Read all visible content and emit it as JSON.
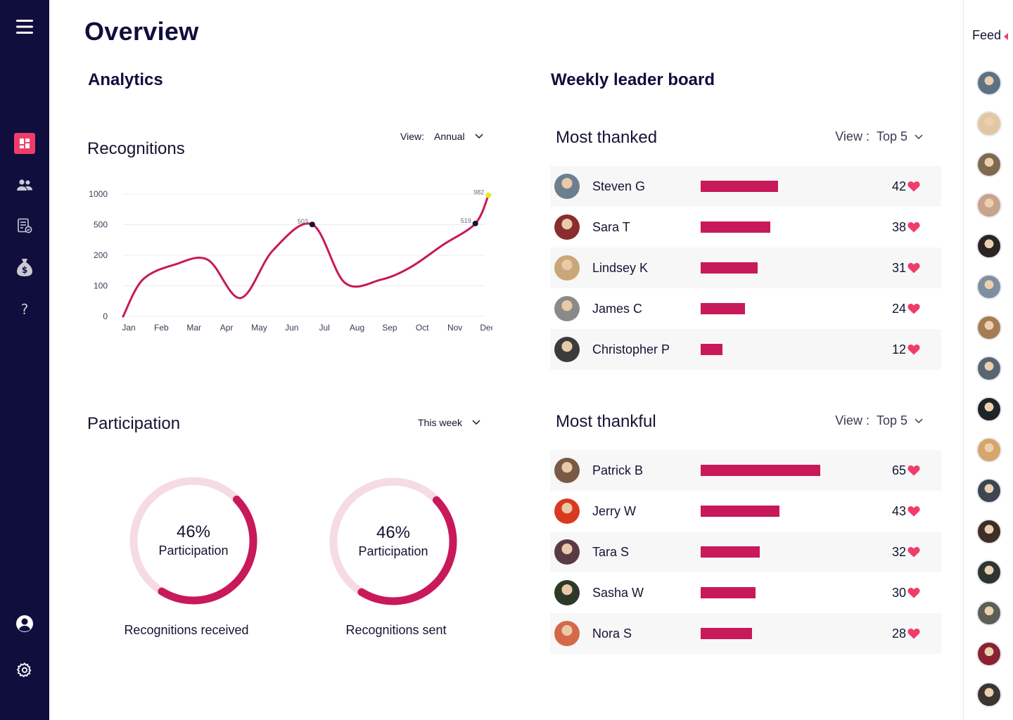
{
  "page": {
    "title": "Overview"
  },
  "sidebar": {
    "menu_icon": "hamburger-menu-icon",
    "items": [
      {
        "icon": "dashboard-icon",
        "active": true
      },
      {
        "icon": "people-icon",
        "active": false
      },
      {
        "icon": "report-icon",
        "active": false
      },
      {
        "icon": "money-bag-icon",
        "active": false
      },
      {
        "icon": "help-icon",
        "glyph": "?",
        "active": false
      }
    ],
    "bottom": [
      {
        "icon": "account-icon"
      },
      {
        "icon": "settings-gear-icon"
      }
    ]
  },
  "analytics": {
    "title": "Analytics",
    "recognitions": {
      "title": "Recognitions",
      "view_label": "View:",
      "view_value": "Annual"
    },
    "participation": {
      "title": "Participation",
      "period": "This week",
      "donuts": [
        {
          "percent_text": "46%",
          "label": "Participation",
          "caption": "Recognitions received",
          "fraction": 0.46
        },
        {
          "percent_text": "46%",
          "label": "Participation",
          "caption": "Recognitions sent",
          "fraction": 0.46
        }
      ]
    }
  },
  "chart_data": {
    "type": "line",
    "categories": [
      "Jan",
      "Feb",
      "Mar",
      "Apr",
      "May",
      "Jun",
      "Jul",
      "Aug",
      "Sep",
      "Oct",
      "Nov",
      "Dec"
    ],
    "yticks": [
      0,
      100,
      200,
      500,
      1000
    ],
    "series": [
      {
        "values": [
          0,
          120,
          170,
          185,
          60,
          250,
          503,
          110,
          120,
          160,
          300,
          519,
          982
        ]
      }
    ],
    "x": [
      0,
      0.6,
      1.6,
      2.6,
      3.6,
      4.6,
      5.8,
      6.8,
      7.9,
      8.8,
      9.8,
      10.8,
      11.2
    ],
    "annotations": [
      {
        "label": "503",
        "x": 5.8,
        "y": 503
      },
      {
        "label": "519",
        "x": 10.8,
        "y": 519
      },
      {
        "label": "982",
        "x": 11.2,
        "y": 982
      }
    ],
    "colors": {
      "line": "#c8195a",
      "marker": "#141433",
      "end_marker": "#e6e62a"
    },
    "grid": true
  },
  "leaderboard": {
    "title": "Weekly leader board",
    "most_thanked": {
      "title": "Most thanked",
      "view_label": "View :",
      "view_value": "Top 5",
      "rows": [
        {
          "name": "Steven G",
          "score": "42",
          "value": 42,
          "avatar": "#6b7f8f"
        },
        {
          "name": "Sara T",
          "score": "38",
          "value": 38,
          "avatar": "#8a2d2d"
        },
        {
          "name": "Lindsey K",
          "score": "31",
          "value": 31,
          "avatar": "#c9a77a"
        },
        {
          "name": "James C",
          "score": "24",
          "value": 24,
          "avatar": "#8a8a8a"
        },
        {
          "name": "Christopher P",
          "score": "12",
          "value": 12,
          "avatar": "#3b3b3b"
        }
      ]
    },
    "most_thankful": {
      "title": "Most thankful",
      "view_label": "View :",
      "view_value": "Top 5",
      "rows": [
        {
          "name": "Patrick B",
          "score": "65",
          "value": 65,
          "avatar": "#7a5a44"
        },
        {
          "name": "Jerry W",
          "score": "43",
          "value": 43,
          "avatar": "#d9391f"
        },
        {
          "name": "Tara S",
          "score": "32",
          "value": 32,
          "avatar": "#5a3a44"
        },
        {
          "name": "Sasha W",
          "score": "30",
          "value": 30,
          "avatar": "#2d3a2a"
        },
        {
          "name": "Nora S",
          "score": "28",
          "value": 28,
          "avatar": "#d4694a"
        }
      ]
    }
  },
  "feed": {
    "title": "Feed",
    "avatars": [
      "#5d7384",
      "#e3c7a0",
      "#7f6a4f",
      "#c9a38a",
      "#2a2524",
      "#7d8fa0",
      "#a67c52",
      "#5a6572",
      "#1f2428",
      "#d6a56a",
      "#3d4650",
      "#3f2e26",
      "#2e3530",
      "#5b5f55",
      "#8a2230",
      "#3a3530"
    ]
  },
  "colors": {
    "sidebar": "#0f0e3d",
    "accent": "#ef3d6a",
    "bar": "#c8195a",
    "donut_track": "#f6dbe4"
  }
}
